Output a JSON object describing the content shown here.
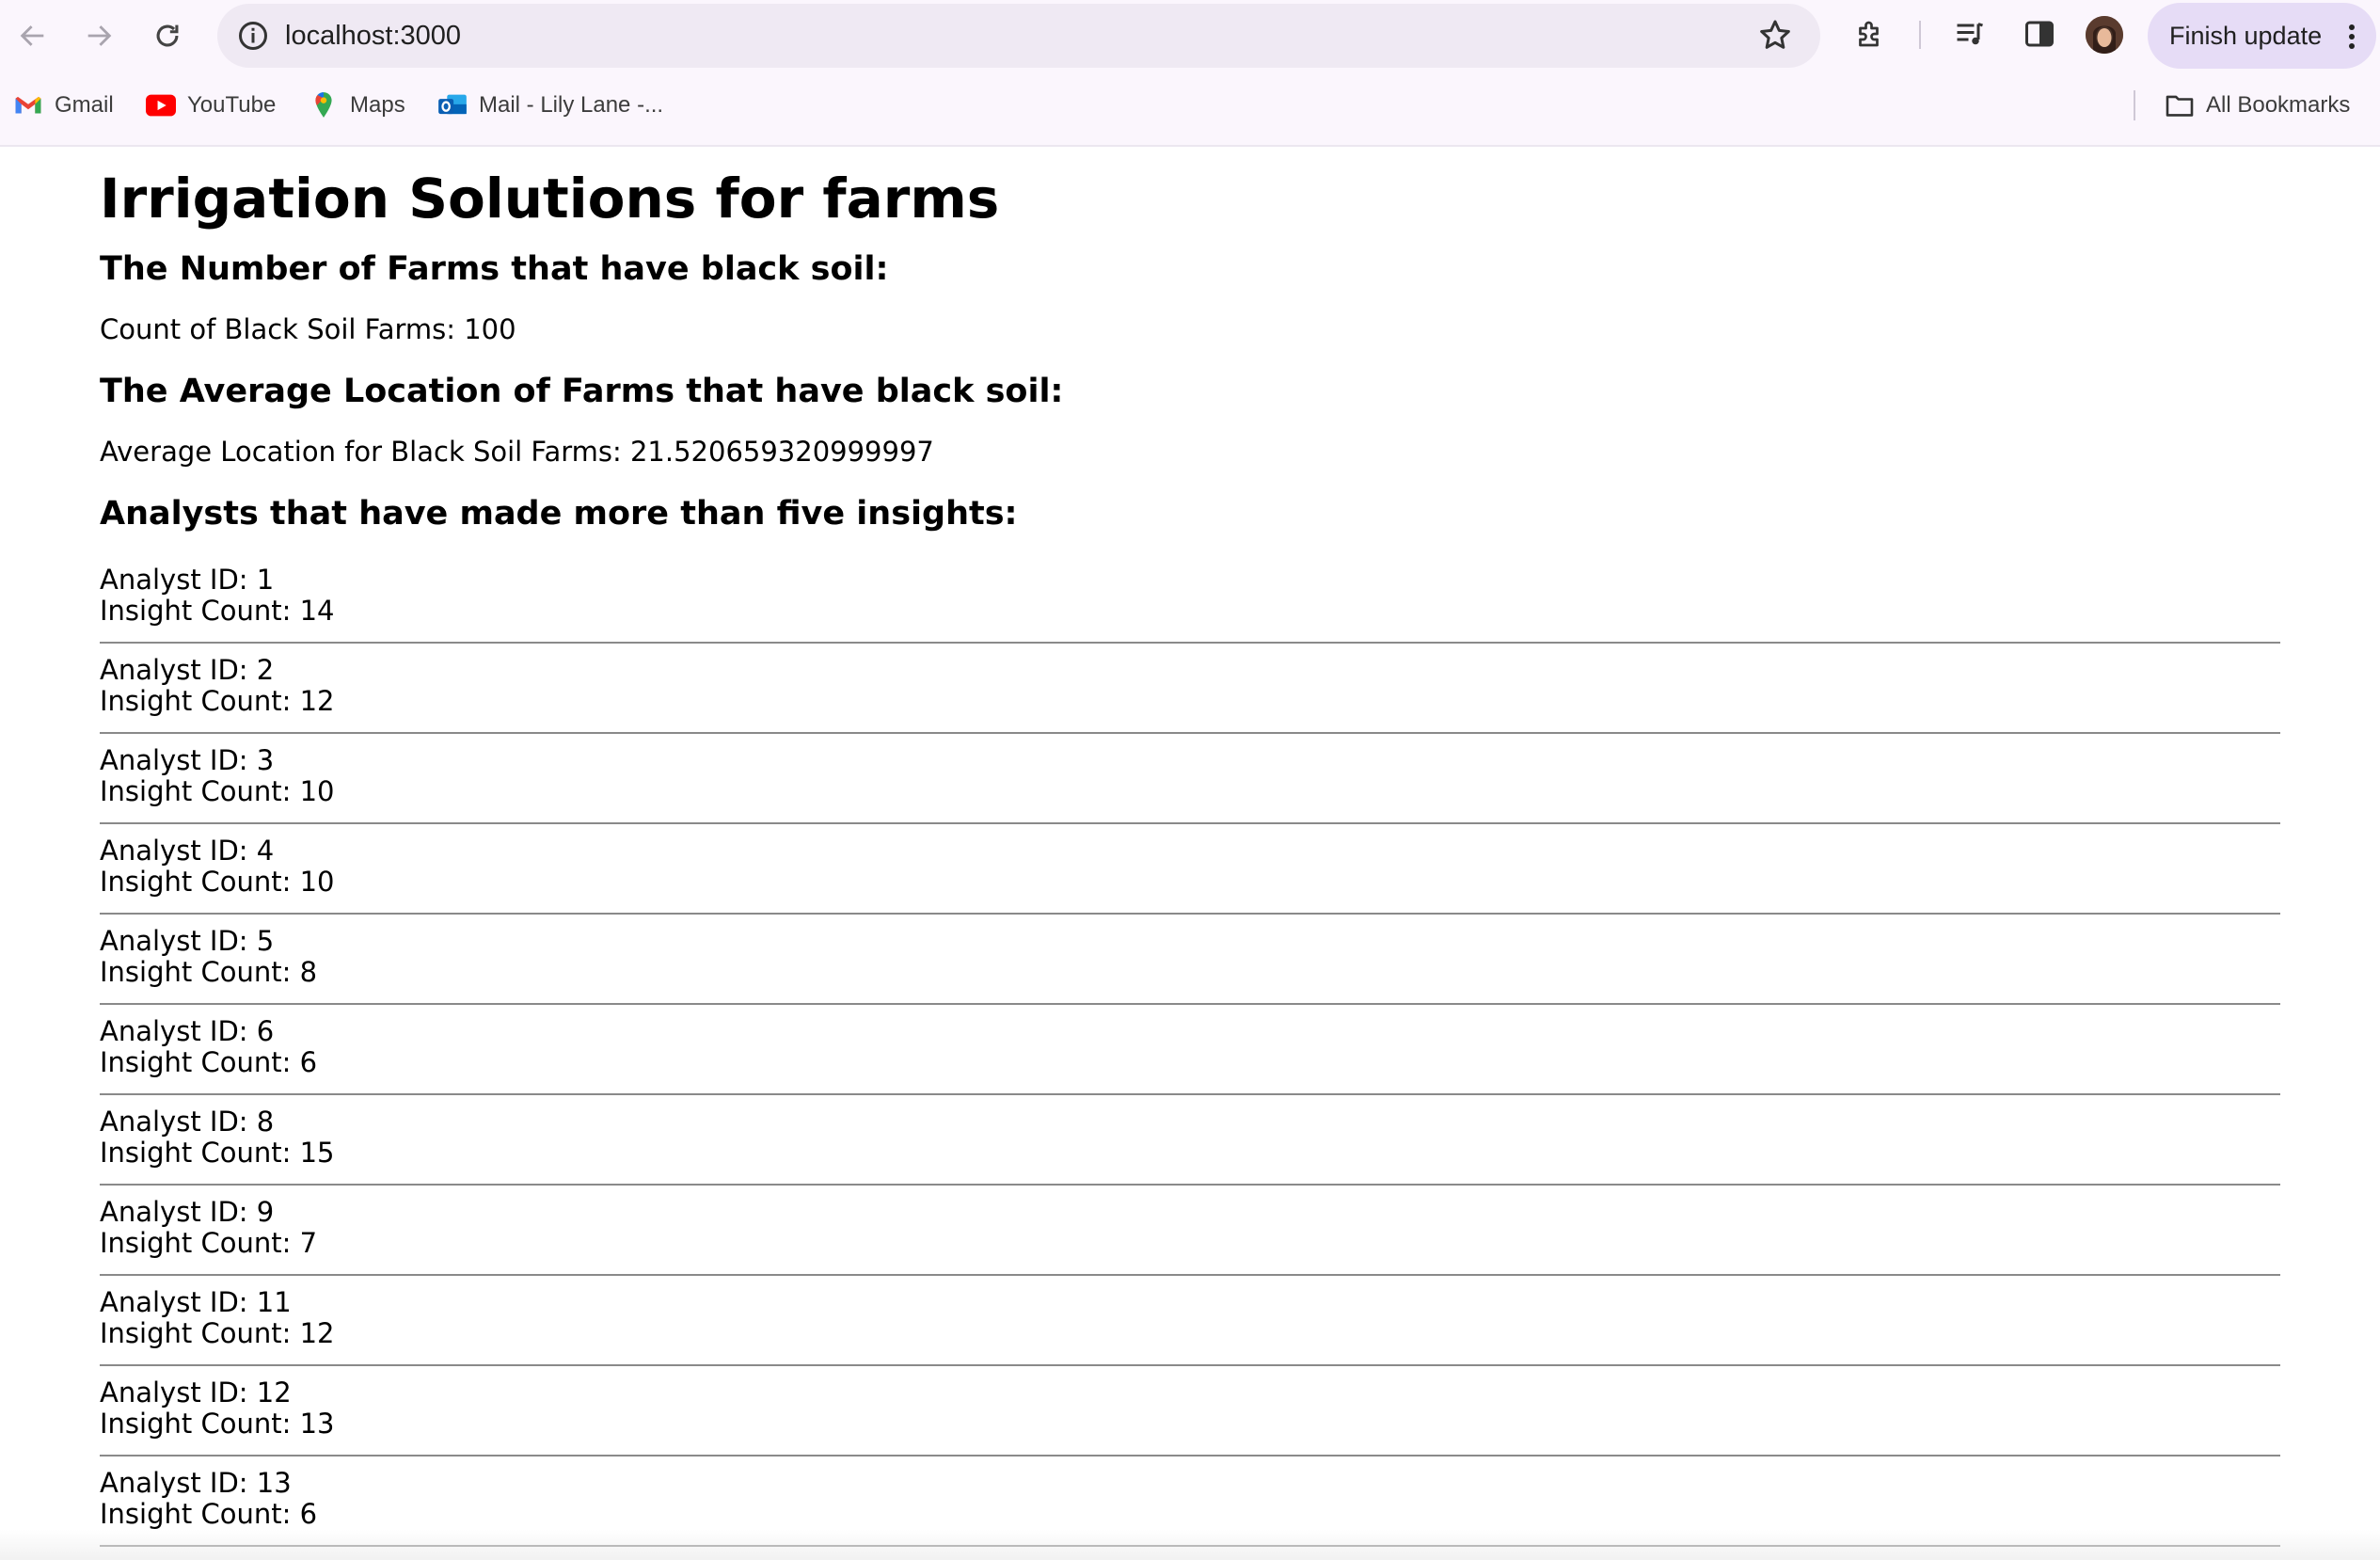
{
  "browser": {
    "url": "localhost:3000",
    "update_label": "Finish update",
    "bookmarks": [
      {
        "label": "Gmail",
        "icon": "gmail-icon"
      },
      {
        "label": "YouTube",
        "icon": "youtube-icon"
      },
      {
        "label": "Maps",
        "icon": "maps-icon"
      },
      {
        "label": "Mail - Lily Lane -...",
        "icon": "outlook-icon"
      }
    ],
    "all_bookmarks_label": "All Bookmarks"
  },
  "page": {
    "title": "Irrigation Solutions for farms",
    "section1_heading": "The Number of Farms that have black soil:",
    "count_text": "Count of Black Soil Farms: 100",
    "section2_heading": "The Average Location of Farms that have black soil:",
    "avg_text": "Average Location for Black Soil Farms: 21.520659320999997",
    "section3_heading": "Analysts that have made more than five insights:",
    "analysts": [
      {
        "id": "Analyst ID: 1",
        "count": "Insight Count: 14"
      },
      {
        "id": "Analyst ID: 2",
        "count": "Insight Count: 12"
      },
      {
        "id": "Analyst ID: 3",
        "count": "Insight Count: 10"
      },
      {
        "id": "Analyst ID: 4",
        "count": "Insight Count: 10"
      },
      {
        "id": "Analyst ID: 5",
        "count": "Insight Count: 8"
      },
      {
        "id": "Analyst ID: 6",
        "count": "Insight Count: 6"
      },
      {
        "id": "Analyst ID: 8",
        "count": "Insight Count: 15"
      },
      {
        "id": "Analyst ID: 9",
        "count": "Insight Count: 7"
      },
      {
        "id": "Analyst ID: 11",
        "count": "Insight Count: 12"
      },
      {
        "id": "Analyst ID: 12",
        "count": "Insight Count: 13"
      },
      {
        "id": "Analyst ID: 13",
        "count": "Insight Count: 6"
      }
    ]
  }
}
